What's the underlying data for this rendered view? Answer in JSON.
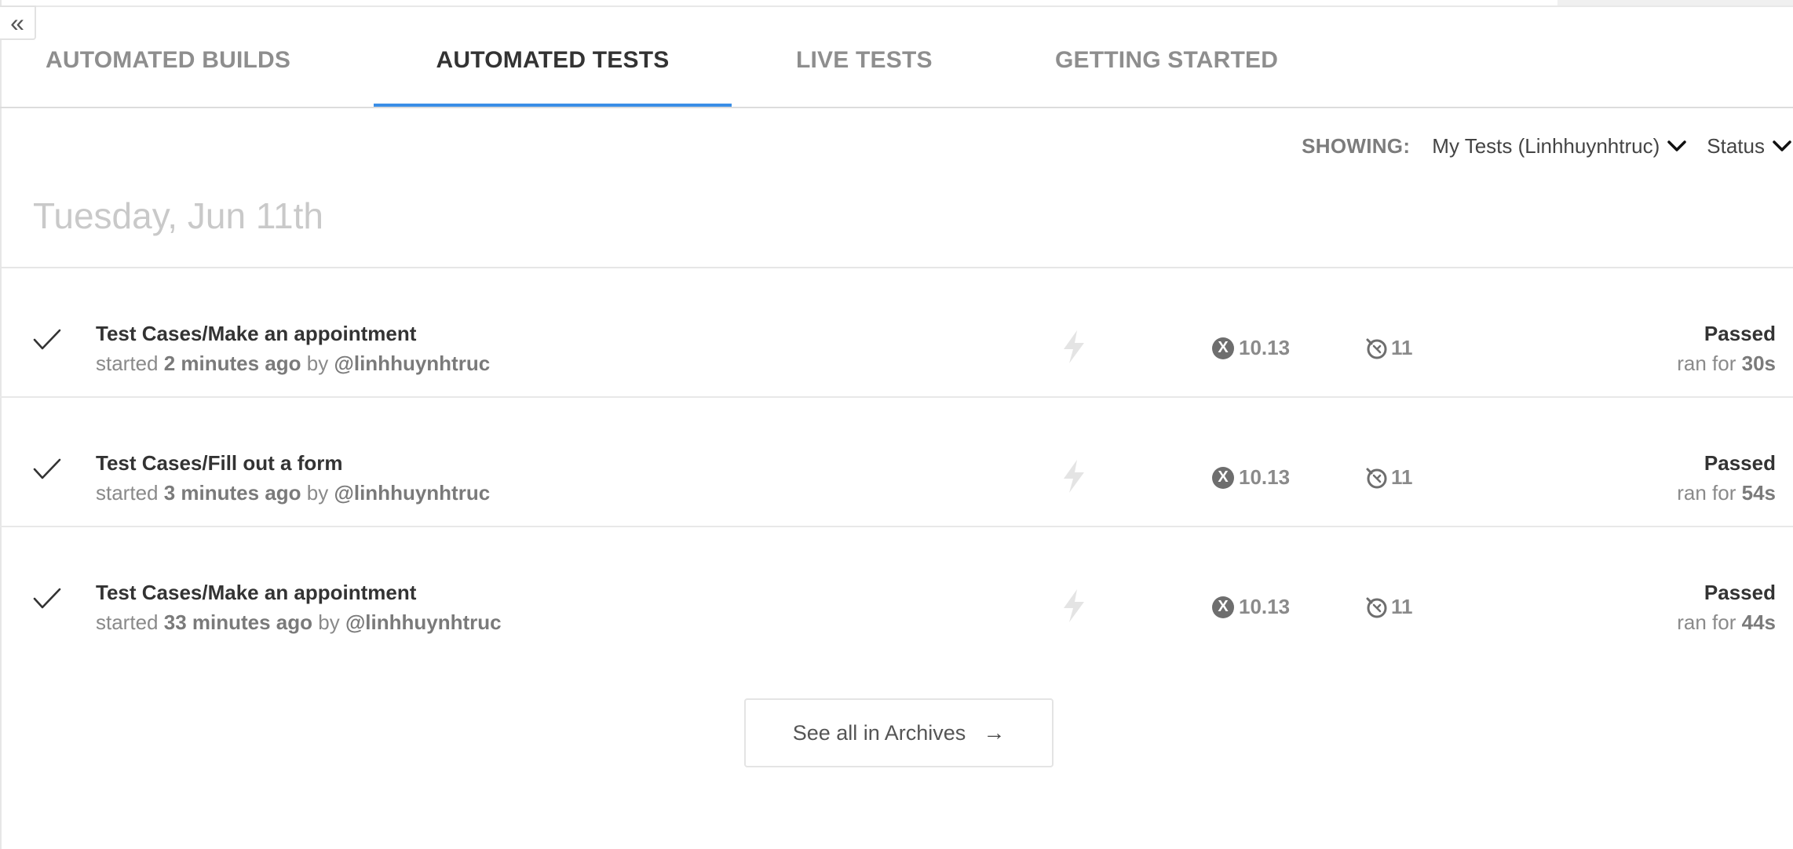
{
  "tabs": [
    {
      "label": "AUTOMATED BUILDS"
    },
    {
      "label": "AUTOMATED TESTS"
    },
    {
      "label": "LIVE TESTS"
    },
    {
      "label": "GETTING STARTED"
    }
  ],
  "active_tab": "AUTOMATED TESTS",
  "accent_color": "#3a8ee6",
  "filters": {
    "showing_label": "SHOWING:",
    "user_filter": "My Tests (Linhhuynhtruc)",
    "status_filter": "Status"
  },
  "date_heading": "Tuesday, Jun 11th",
  "tests": [
    {
      "name": "Test Cases/Make an appointment",
      "started_prefix": "started",
      "started_ago": "2 minutes ago",
      "by_text": "by",
      "user": "@linhhuynhtruc",
      "os_version": "10.13",
      "browser_version": "11",
      "status": "Passed",
      "ran_prefix": "ran for",
      "duration": "30s"
    },
    {
      "name": "Test Cases/Fill out a form",
      "started_prefix": "started",
      "started_ago": "3 minutes ago",
      "by_text": "by",
      "user": "@linhhuynhtruc",
      "os_version": "10.13",
      "browser_version": "11",
      "status": "Passed",
      "ran_prefix": "ran for",
      "duration": "54s"
    },
    {
      "name": "Test Cases/Make an appointment",
      "started_prefix": "started",
      "started_ago": "33 minutes ago",
      "by_text": "by",
      "user": "@linhhuynhtruc",
      "os_version": "10.13",
      "browser_version": "11",
      "status": "Passed",
      "ran_prefix": "ran for",
      "duration": "44s"
    }
  ],
  "icons": {
    "collapse": "double-chevron-left-icon",
    "check": "check-icon",
    "bolt": "lightning-icon",
    "os": "macos-x-icon",
    "browser": "safari-compass-icon",
    "dropdown": "chevron-down-icon",
    "arrow": "arrow-right-icon"
  },
  "archive_button": {
    "label": "See all in Archives",
    "arrow": "→"
  }
}
